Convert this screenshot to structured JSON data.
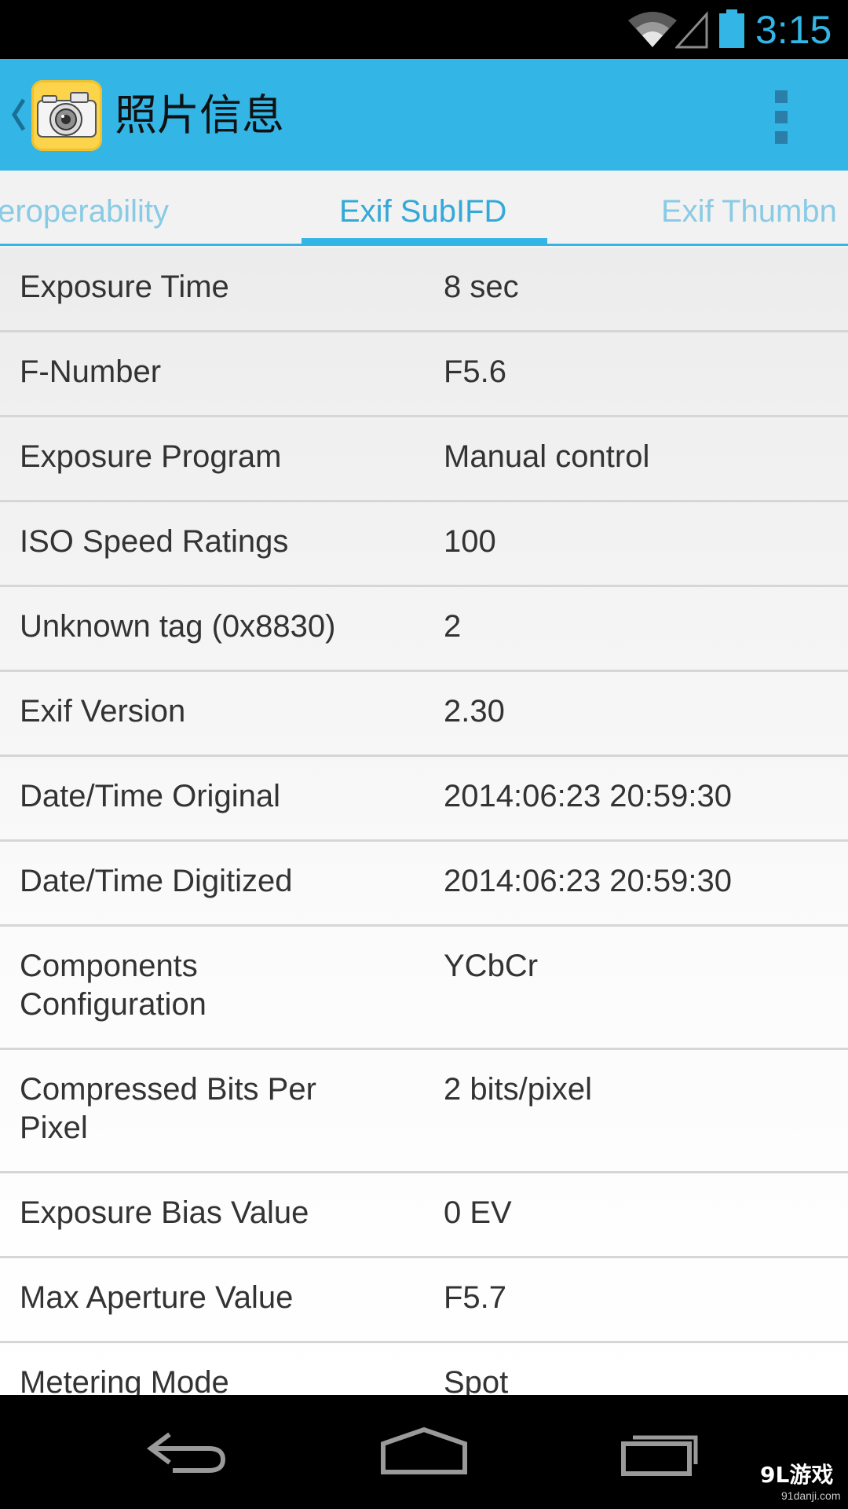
{
  "status_bar": {
    "time": "3:15",
    "icons": [
      "wifi-icon",
      "cell-signal-icon",
      "battery-icon"
    ]
  },
  "action_bar": {
    "title": "照片信息",
    "app_icon": "camera-app-icon",
    "overflow_icon": "overflow-menu-icon",
    "color": "#33b5e5"
  },
  "tabs": {
    "items": [
      {
        "label": "teroperability",
        "active": false
      },
      {
        "label": "Exif SubIFD",
        "active": true
      },
      {
        "label": "Exif Thumbn",
        "active": false
      }
    ],
    "accent": "#33b5e5"
  },
  "properties": [
    {
      "label": "Exposure Time",
      "value": "8 sec"
    },
    {
      "label": "F-Number",
      "value": "F5.6"
    },
    {
      "label": "Exposure Program",
      "value": "Manual control"
    },
    {
      "label": "ISO Speed Ratings",
      "value": "100"
    },
    {
      "label": "Unknown tag (0x8830)",
      "value": "2"
    },
    {
      "label": "Exif Version",
      "value": "2.30"
    },
    {
      "label": "Date/Time Original",
      "value": "2014:06:23 20:59:30"
    },
    {
      "label": "Date/Time Digitized",
      "value": "2014:06:23 20:59:30"
    },
    {
      "label": "Components Configuration",
      "value": "YCbCr"
    },
    {
      "label": "Compressed Bits Per Pixel",
      "value": "2 bits/pixel"
    },
    {
      "label": "Exposure Bias Value",
      "value": "0 EV"
    },
    {
      "label": "Max Aperture Value",
      "value": "F5.7"
    },
    {
      "label": "Metering Mode",
      "value": "Spot"
    }
  ],
  "nav_bar": {
    "buttons": [
      "back-icon",
      "home-icon",
      "recent-apps-icon"
    ],
    "watermark": "9L游戏",
    "watermark_sub": "91danji.com"
  }
}
